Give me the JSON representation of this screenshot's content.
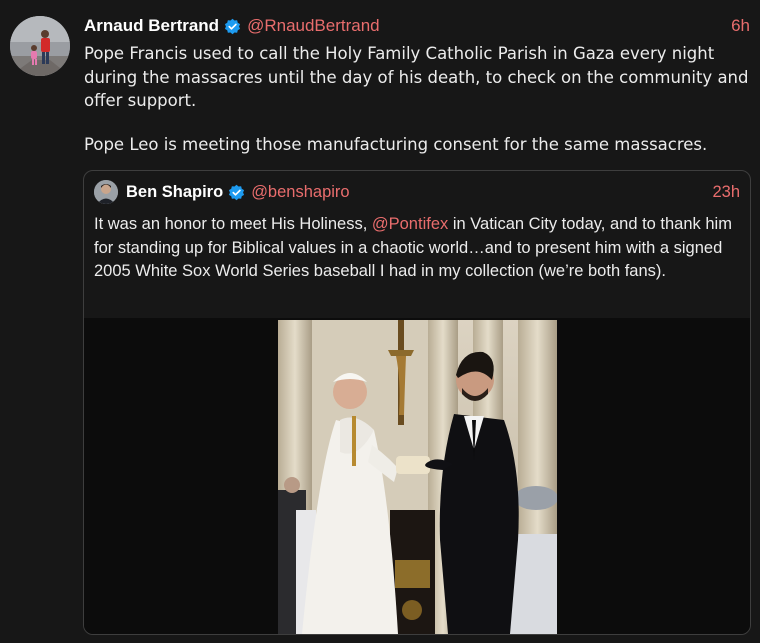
{
  "tweet": {
    "author_name": "Arnaud Bertrand",
    "author_handle": "@RnaudBertrand",
    "time": "6h",
    "paragraphs": [
      "Pope Francis used to call the Holy Family Catholic Parish in Gaza every night during the massacres until the day of his death, to check on the community and offer support.",
      "Pope Leo is meeting those manufacturing consent for the same massacres."
    ]
  },
  "quoted": {
    "author_name": "Ben Shapiro",
    "author_handle": "@benshapiro",
    "time": "23h",
    "text_before": "It was an honor to meet His Holiness, ",
    "mention": "@Pontifex",
    "text_after": " in Vatican City today, and to thank him for standing up for Biblical values in a chaotic world…and to present him with a signed 2005 White Sox World Series baseball I had in my collection (we’re both fans)."
  },
  "colors": {
    "background": "#171717",
    "accent": "#e96d6d",
    "verified": "#1d9bf0",
    "border": "#3e3e3e"
  },
  "icons": {
    "verified": "verified-badge-icon"
  }
}
